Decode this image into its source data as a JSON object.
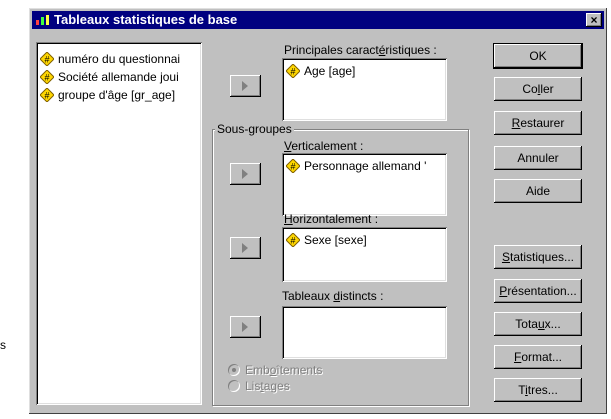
{
  "window": {
    "title": "Tableaux statistiques de base",
    "close_label": "×"
  },
  "colors": {
    "titlebar": "#000080",
    "dialog_bg": "#c0c0c0",
    "var_icon_fill": "#ffd700"
  },
  "source_list": {
    "items": [
      {
        "label": "numéro du questionnai",
        "icon": "numeric-variable-icon"
      },
      {
        "label": "Société allemande joui",
        "icon": "numeric-variable-icon"
      },
      {
        "label": "groupe d'âge [gr_age]",
        "icon": "numeric-variable-icon"
      }
    ]
  },
  "main": {
    "label_pre": "Principales caract",
    "label_u": "é",
    "label_post": "ristiques :",
    "items": [
      {
        "label": "Age [age]",
        "icon": "numeric-variable-icon"
      }
    ]
  },
  "subgroups": {
    "legend": "Sous-groupes",
    "vertical": {
      "label_u": "V",
      "label_post": "erticalement :",
      "items": [
        {
          "label": "Personnage allemand '"
        }
      ]
    },
    "horizontal": {
      "label_u": "H",
      "label_post": "orizontalement :",
      "items": [
        {
          "label": "Sexe [sexe]"
        }
      ]
    },
    "distinct": {
      "label_pre": "Tableaux ",
      "label_u": "d",
      "label_post": "istincts :",
      "items": []
    },
    "options": [
      {
        "label_pre": "Emb",
        "label_u": "o",
        "label_post": "îtements",
        "selected": true
      },
      {
        "label_pre": "Lis",
        "label_u": "t",
        "label_post": "ages",
        "selected": false
      }
    ]
  },
  "buttons": {
    "ok": "OK",
    "coller_pre": "Co",
    "coller_u": "l",
    "coller_post": "ler",
    "restaurer_u": "R",
    "restaurer_post": "estaurer",
    "annuler": "Annuler",
    "aide": "Aide",
    "statistiques_u": "S",
    "statistiques_post": "tatistiques...",
    "presentation_u": "P",
    "presentation_post": "résentation...",
    "totaux_pre": "Tota",
    "totaux_u": "u",
    "totaux_post": "x...",
    "format_u": "F",
    "format_post": "ormat...",
    "titres_pre": "T",
    "titres_u": "i",
    "titres_post": "tres..."
  },
  "background": {
    "stray_text": "s"
  }
}
